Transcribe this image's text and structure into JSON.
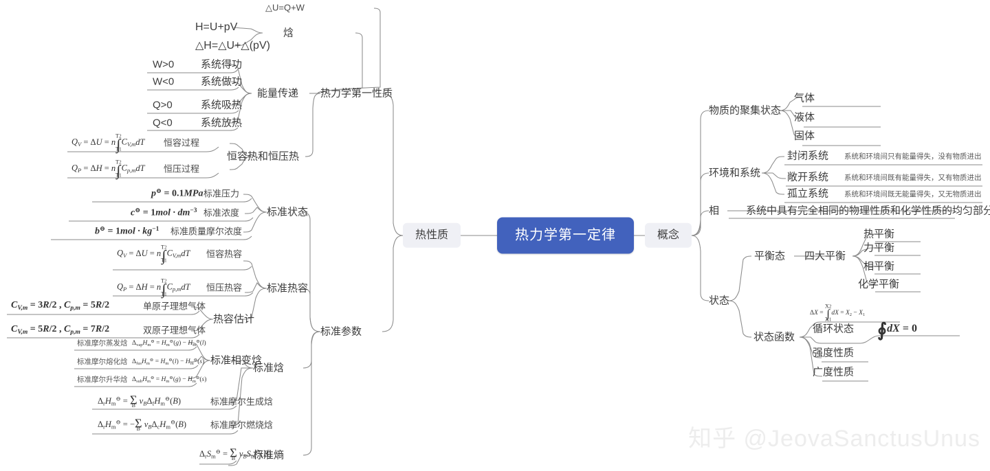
{
  "root": {
    "label": "热力学第一定律",
    "color": "#4262bd"
  },
  "branches": {
    "left": {
      "label": "热性质"
    },
    "right": {
      "label": "概念"
    }
  },
  "left_tree": {
    "first_property": {
      "label": "热力学第一性质",
      "children": {
        "delta_u": "△U=Q+W",
        "enthalpy": {
          "label": "焓",
          "items": [
            "H=U+pV",
            "△H=△U+△(pV)"
          ]
        },
        "energy_transfer": {
          "label": "能量传递",
          "rows": [
            {
              "symbol": "W>0",
              "text": "系统得功"
            },
            {
              "symbol": "W<0",
              "text": "系统做功"
            },
            {
              "symbol": "Q>0",
              "text": "系统吸热"
            },
            {
              "symbol": "Q<0",
              "text": "系统放热"
            }
          ]
        },
        "cv_cp_heat": {
          "label": "恒容热和恒压热",
          "rows": [
            {
              "formula": "Q_V = ΔU = n∫_{T1}^{T2} C_{V,m} dT",
              "text": "恒容过程"
            },
            {
              "formula": "Q_P = ΔH = n∫_{T1}^{T2} C_{p,m} dT",
              "text": "恒压过程"
            }
          ]
        }
      }
    },
    "standard_params": {
      "label": "标准参数",
      "children": {
        "standard_state": {
          "label": "标准状态",
          "rows": [
            {
              "formula": "p⊖ = 0.1MPa",
              "text": "标准压力"
            },
            {
              "formula": "c⊖ = 1mol·dm⁻³",
              "text": "标准浓度"
            },
            {
              "formula": "b⊖ = 1mol·kg⁻¹",
              "text": "标准质量摩尔浓度"
            }
          ]
        },
        "standard_heat_capacity": {
          "label": "标准热容",
          "rows": [
            {
              "formula": "Q_V = ΔU = n∫_{T1}^{T2} C_{V,m} dT",
              "text": "恒容热容"
            },
            {
              "formula": "Q_P = ΔH = n∫_{T1}^{T2} C_{p,m} dT",
              "text": "恒压热容"
            }
          ],
          "estimate": {
            "label": "热容估计",
            "rows": [
              {
                "formula": "C_{V,m} = 3R/2 , C_{p,m} = 5R/2",
                "text": "单原子理想气体"
              },
              {
                "formula": "C_{V,m} = 5R/2 , C_{p,m} = 7R/2",
                "text": "双原子理想气体"
              }
            ]
          }
        },
        "standard_enthalpy": {
          "label": "标准焓",
          "phase_change": {
            "label": "标准相变焓",
            "rows": [
              {
                "name": "标准摩尔蒸发焓",
                "formula": "Δ_vap H_m⊖ = H_m⊖(g) − H_m⊖(l)"
              },
              {
                "name": "标准摩尔熔化焓",
                "formula": "Δ_fus H_m⊖ = H_m⊖(l) − H_m⊖(s)"
              },
              {
                "name": "标准摩尔升华焓",
                "formula": "Δ_sub H_m⊖ = H_m⊖(g) − H_m⊖(s)"
              }
            ]
          },
          "rows": [
            {
              "formula": "Δ_r H_m⊖ = Σ_B v_B Δ_f H_m⊖(B)",
              "text": "标准摩尔生成焓"
            },
            {
              "formula": "Δ_r H_m⊖ = −Σ_B v_B Δ_c H_m⊖(B)",
              "text": "标准摩尔燃烧焓"
            }
          ]
        },
        "standard_entropy": {
          "label": "标准熵",
          "rows": [
            {
              "formula": "Δ_r S_m⊖ = Σ_B v_B S_m⊖(B)",
              "text": "标准熵"
            }
          ]
        }
      }
    }
  },
  "right_tree": {
    "aggregation": {
      "label": "物质的聚集状态",
      "items": [
        "气体",
        "液体",
        "固体"
      ]
    },
    "env_system": {
      "label": "环境和系统",
      "items": [
        {
          "label": "封闭系统",
          "desc": "系统和环境间只有能量得失，没有物质进出"
        },
        {
          "label": "敞开系统",
          "desc": "系统和环境间既有能量得失，又有物质进出"
        },
        {
          "label": "孤立系统",
          "desc": "系统和环境间既无能量得失，又无物质进出"
        }
      ]
    },
    "phase": {
      "label": "相",
      "desc": "系统中具有完全相同的物理性质和化学性质的均匀部分"
    },
    "state": {
      "label": "状态",
      "equilibrium": {
        "label": "平衡态",
        "four": {
          "label": "四大平衡",
          "items": [
            "热平衡",
            "力平衡",
            "相平衡",
            "化学平衡"
          ]
        }
      },
      "state_function": {
        "label": "状态函数",
        "delta_formula": "ΔX = ∫_{X1}^{X2} dX = X2 − X1",
        "items": [
          {
            "label": "循环状态",
            "formula": "∮dX = 0"
          },
          {
            "label": "强度性质"
          },
          {
            "label": "广度性质"
          }
        ]
      }
    }
  },
  "watermark": {
    "text": "知乎 @JeovaSanctusUnus"
  }
}
